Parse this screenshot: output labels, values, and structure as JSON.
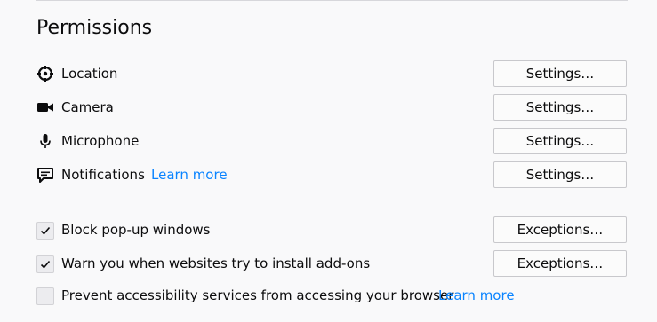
{
  "section": {
    "title": "Permissions"
  },
  "permissions": [
    {
      "label": "Location",
      "icon": "location-crosshair-icon",
      "button": "Settings…"
    },
    {
      "label": "Camera",
      "icon": "camera-icon",
      "button": "Settings…"
    },
    {
      "label": "Microphone",
      "icon": "microphone-icon",
      "button": "Settings…"
    },
    {
      "label": "Notifications",
      "icon": "notification-bubble-icon",
      "button": "Settings…",
      "learn_more": "Learn more"
    }
  ],
  "options": [
    {
      "label": "Block pop-up windows",
      "checked": true,
      "button": "Exceptions…"
    },
    {
      "label": "Warn you when websites try to install add-ons",
      "checked": true,
      "button": "Exceptions…"
    },
    {
      "label": "Prevent accessibility services from accessing your browser",
      "checked": false,
      "learn_more": "Learn more"
    }
  ],
  "colors": {
    "link": "#0a84ff",
    "text": "#0c0c0d",
    "background": "#f9f9fa"
  }
}
